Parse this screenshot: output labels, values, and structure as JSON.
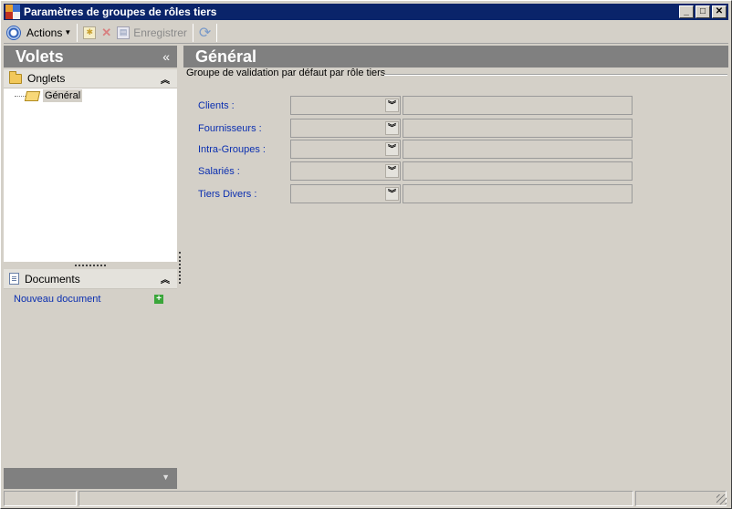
{
  "window": {
    "title": "Paramètres de groupes de rôles tiers",
    "controls": [
      "_",
      "□",
      "✕"
    ]
  },
  "toolbar": {
    "actions_label": "Actions",
    "save_label": "Enregistrer"
  },
  "left_panel": {
    "title": "Volets",
    "collapse_glyph": "«",
    "onglets_label": "Onglets",
    "tree_items": [
      "Général"
    ],
    "documents_label": "Documents",
    "new_document_label": "Nouveau document"
  },
  "main": {
    "title": "Général",
    "group_label": "Groupe de validation par défaut par rôle tiers",
    "rows": [
      {
        "label": "Clients  :"
      },
      {
        "label": "Fournisseurs :"
      },
      {
        "label": "Intra-Groupes :"
      },
      {
        "label": "Salariés :"
      },
      {
        "label": "Tiers Divers :"
      }
    ]
  }
}
